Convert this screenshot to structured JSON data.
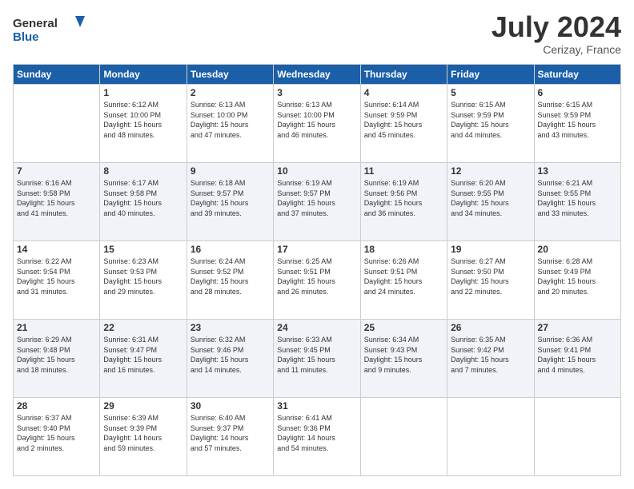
{
  "header": {
    "logo_line1": "General",
    "logo_line2": "Blue",
    "month_year": "July 2024",
    "location": "Cerizay, France"
  },
  "weekdays": [
    "Sunday",
    "Monday",
    "Tuesday",
    "Wednesday",
    "Thursday",
    "Friday",
    "Saturday"
  ],
  "weeks": [
    [
      {
        "day": "",
        "info": ""
      },
      {
        "day": "1",
        "info": "Sunrise: 6:12 AM\nSunset: 10:00 PM\nDaylight: 15 hours\nand 48 minutes."
      },
      {
        "day": "2",
        "info": "Sunrise: 6:13 AM\nSunset: 10:00 PM\nDaylight: 15 hours\nand 47 minutes."
      },
      {
        "day": "3",
        "info": "Sunrise: 6:13 AM\nSunset: 10:00 PM\nDaylight: 15 hours\nand 46 minutes."
      },
      {
        "day": "4",
        "info": "Sunrise: 6:14 AM\nSunset: 9:59 PM\nDaylight: 15 hours\nand 45 minutes."
      },
      {
        "day": "5",
        "info": "Sunrise: 6:15 AM\nSunset: 9:59 PM\nDaylight: 15 hours\nand 44 minutes."
      },
      {
        "day": "6",
        "info": "Sunrise: 6:15 AM\nSunset: 9:59 PM\nDaylight: 15 hours\nand 43 minutes."
      }
    ],
    [
      {
        "day": "7",
        "info": "Sunrise: 6:16 AM\nSunset: 9:58 PM\nDaylight: 15 hours\nand 41 minutes."
      },
      {
        "day": "8",
        "info": "Sunrise: 6:17 AM\nSunset: 9:58 PM\nDaylight: 15 hours\nand 40 minutes."
      },
      {
        "day": "9",
        "info": "Sunrise: 6:18 AM\nSunset: 9:57 PM\nDaylight: 15 hours\nand 39 minutes."
      },
      {
        "day": "10",
        "info": "Sunrise: 6:19 AM\nSunset: 9:57 PM\nDaylight: 15 hours\nand 37 minutes."
      },
      {
        "day": "11",
        "info": "Sunrise: 6:19 AM\nSunset: 9:56 PM\nDaylight: 15 hours\nand 36 minutes."
      },
      {
        "day": "12",
        "info": "Sunrise: 6:20 AM\nSunset: 9:55 PM\nDaylight: 15 hours\nand 34 minutes."
      },
      {
        "day": "13",
        "info": "Sunrise: 6:21 AM\nSunset: 9:55 PM\nDaylight: 15 hours\nand 33 minutes."
      }
    ],
    [
      {
        "day": "14",
        "info": "Sunrise: 6:22 AM\nSunset: 9:54 PM\nDaylight: 15 hours\nand 31 minutes."
      },
      {
        "day": "15",
        "info": "Sunrise: 6:23 AM\nSunset: 9:53 PM\nDaylight: 15 hours\nand 29 minutes."
      },
      {
        "day": "16",
        "info": "Sunrise: 6:24 AM\nSunset: 9:52 PM\nDaylight: 15 hours\nand 28 minutes."
      },
      {
        "day": "17",
        "info": "Sunrise: 6:25 AM\nSunset: 9:51 PM\nDaylight: 15 hours\nand 26 minutes."
      },
      {
        "day": "18",
        "info": "Sunrise: 6:26 AM\nSunset: 9:51 PM\nDaylight: 15 hours\nand 24 minutes."
      },
      {
        "day": "19",
        "info": "Sunrise: 6:27 AM\nSunset: 9:50 PM\nDaylight: 15 hours\nand 22 minutes."
      },
      {
        "day": "20",
        "info": "Sunrise: 6:28 AM\nSunset: 9:49 PM\nDaylight: 15 hours\nand 20 minutes."
      }
    ],
    [
      {
        "day": "21",
        "info": "Sunrise: 6:29 AM\nSunset: 9:48 PM\nDaylight: 15 hours\nand 18 minutes."
      },
      {
        "day": "22",
        "info": "Sunrise: 6:31 AM\nSunset: 9:47 PM\nDaylight: 15 hours\nand 16 minutes."
      },
      {
        "day": "23",
        "info": "Sunrise: 6:32 AM\nSunset: 9:46 PM\nDaylight: 15 hours\nand 14 minutes."
      },
      {
        "day": "24",
        "info": "Sunrise: 6:33 AM\nSunset: 9:45 PM\nDaylight: 15 hours\nand 11 minutes."
      },
      {
        "day": "25",
        "info": "Sunrise: 6:34 AM\nSunset: 9:43 PM\nDaylight: 15 hours\nand 9 minutes."
      },
      {
        "day": "26",
        "info": "Sunrise: 6:35 AM\nSunset: 9:42 PM\nDaylight: 15 hours\nand 7 minutes."
      },
      {
        "day": "27",
        "info": "Sunrise: 6:36 AM\nSunset: 9:41 PM\nDaylight: 15 hours\nand 4 minutes."
      }
    ],
    [
      {
        "day": "28",
        "info": "Sunrise: 6:37 AM\nSunset: 9:40 PM\nDaylight: 15 hours\nand 2 minutes."
      },
      {
        "day": "29",
        "info": "Sunrise: 6:39 AM\nSunset: 9:39 PM\nDaylight: 14 hours\nand 59 minutes."
      },
      {
        "day": "30",
        "info": "Sunrise: 6:40 AM\nSunset: 9:37 PM\nDaylight: 14 hours\nand 57 minutes."
      },
      {
        "day": "31",
        "info": "Sunrise: 6:41 AM\nSunset: 9:36 PM\nDaylight: 14 hours\nand 54 minutes."
      },
      {
        "day": "",
        "info": ""
      },
      {
        "day": "",
        "info": ""
      },
      {
        "day": "",
        "info": ""
      }
    ]
  ]
}
